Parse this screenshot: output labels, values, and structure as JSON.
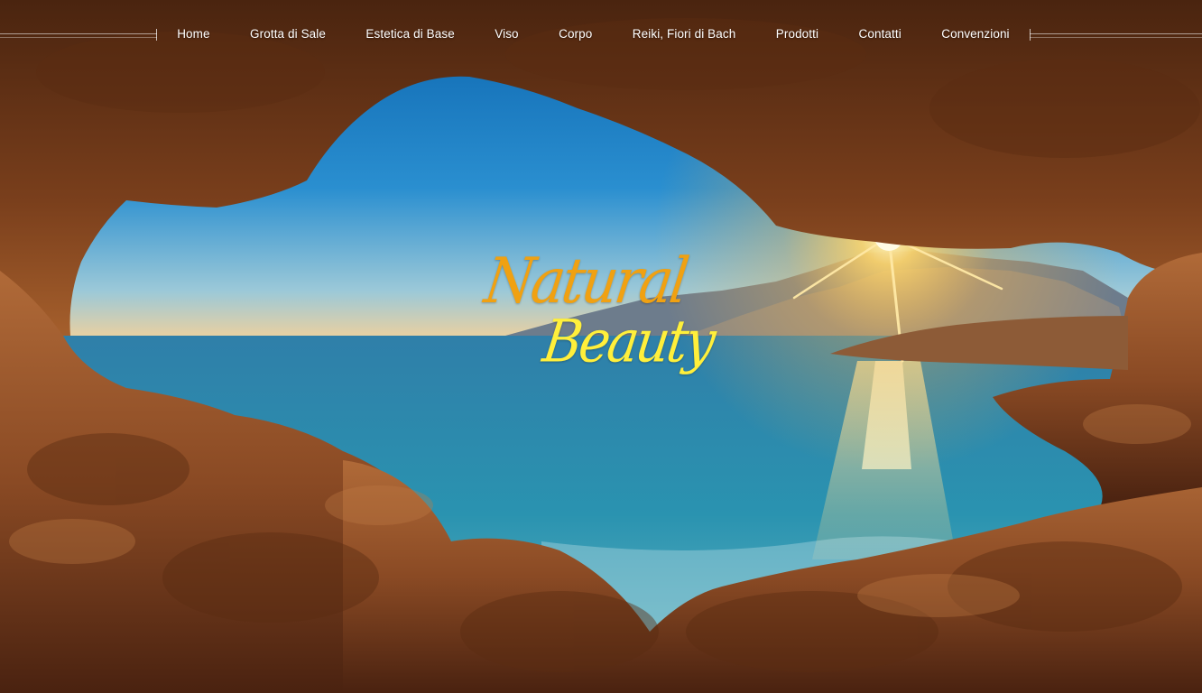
{
  "nav": {
    "items": [
      {
        "label": "Home"
      },
      {
        "label": "Grotta di Sale"
      },
      {
        "label": "Estetica di Base"
      },
      {
        "label": "Viso"
      },
      {
        "label": "Corpo"
      },
      {
        "label": "Reiki, Fiori di Bach"
      },
      {
        "label": "Prodotti"
      },
      {
        "label": "Contatti"
      },
      {
        "label": "Convenzioni"
      }
    ]
  },
  "hero": {
    "logo_line1": "Natural",
    "logo_line2": "Beauty",
    "logo_colors": {
      "line1": "#f0a112",
      "line2": "#ffef3b"
    }
  },
  "colors": {
    "nav_text": "#ffffff",
    "sky_top": "#0f6fb8",
    "sea": "#2d8db0",
    "rock": "#8a4b22"
  }
}
